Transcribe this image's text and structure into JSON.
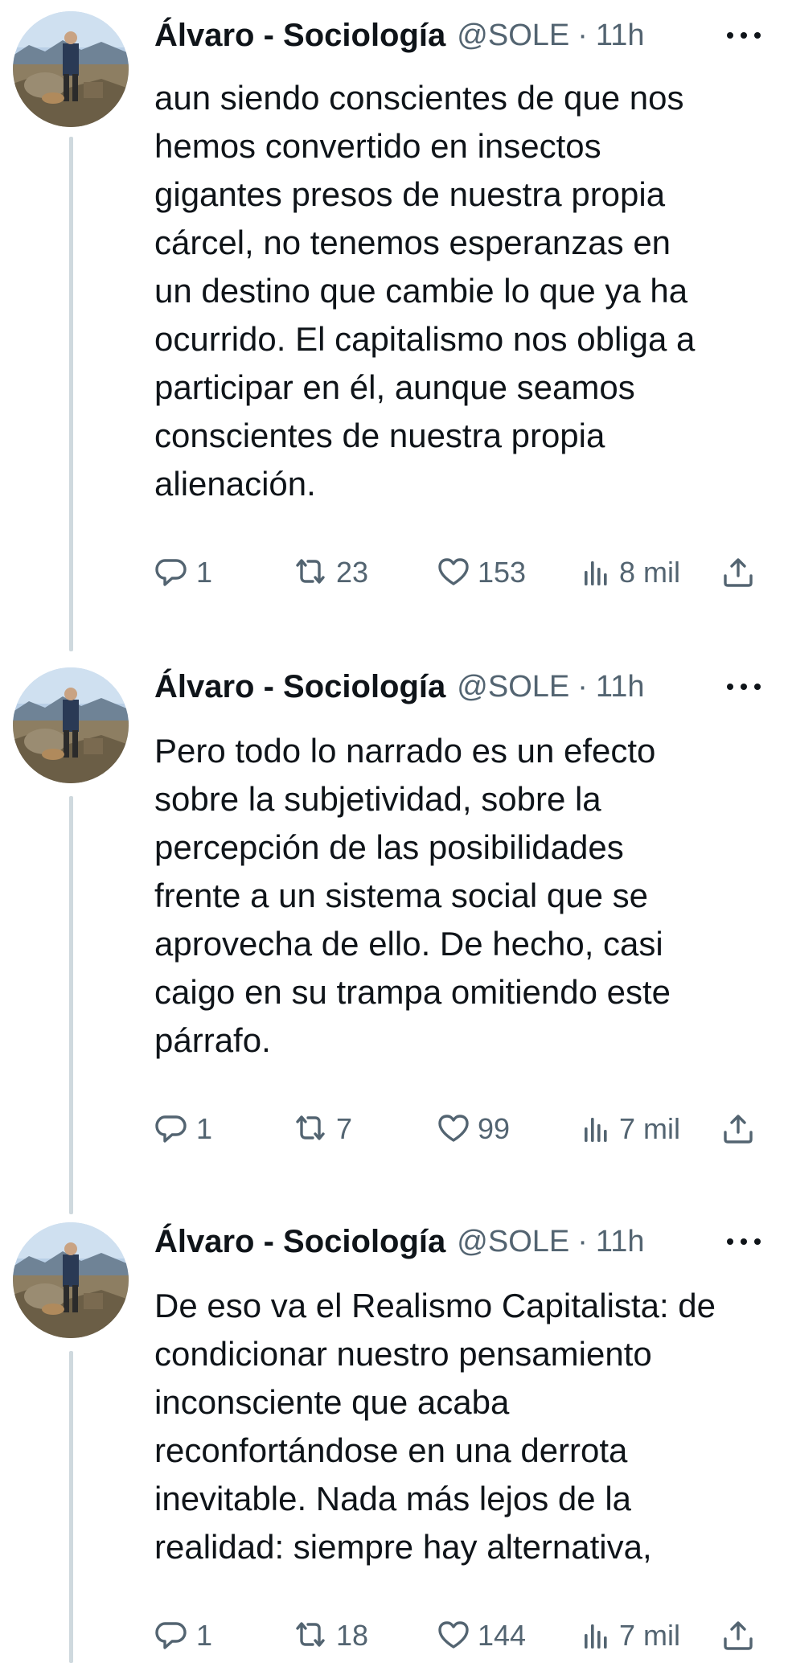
{
  "tweets": [
    {
      "author_name": "Álvaro - Sociología",
      "handle": "@SOLE",
      "separator": "·",
      "time": "11h",
      "lines": [
        "aun siendo conscientes de que nos",
        "hemos convertido en insectos",
        "gigantes presos de nuestra propia",
        "cárcel, no tenemos esperanzas en",
        "un destino que cambie lo que ya ha",
        "ocurrido. El capitalismo nos obliga a",
        "participar en él, aunque seamos",
        "conscientes de nuestra propia",
        "alienación."
      ],
      "replies": "1",
      "retweets": "23",
      "likes": "153",
      "views": "8 mil"
    },
    {
      "author_name": "Álvaro - Sociología",
      "handle": "@SOLE",
      "separator": "·",
      "time": "11h",
      "lines": [
        "Pero todo lo narrado es un efecto",
        "sobre la subjetividad, sobre la",
        "percepción de las posibilidades",
        "frente a un sistema social que se",
        "aprovecha de ello. De hecho, casi",
        "caigo en su trampa omitiendo este",
        "párrafo."
      ],
      "replies": "1",
      "retweets": "7",
      "likes": "99",
      "views": "7 mil"
    },
    {
      "author_name": "Álvaro - Sociología",
      "handle": "@SOLE",
      "separator": "·",
      "time": "11h",
      "lines": [
        "De eso va el Realismo Capitalista: de",
        "condicionar nuestro pensamiento",
        "inconsciente que acaba",
        "reconfortándose en una derrota",
        "inevitable. Nada más lejos de la",
        "realidad: siempre hay alternativa,"
      ],
      "replies": "1",
      "retweets": "18",
      "likes": "144",
      "views": "7 mil"
    }
  ],
  "icons": {
    "reply": "speech-bubble-icon",
    "retweet": "retweet-arrows-icon",
    "like": "heart-icon",
    "views": "bar-chart-icon",
    "share": "share-upload-icon",
    "more": "more-dots-icon"
  },
  "colors": {
    "text": "#0f1419",
    "secondary": "#536471",
    "thread_line": "#cfd9de"
  }
}
